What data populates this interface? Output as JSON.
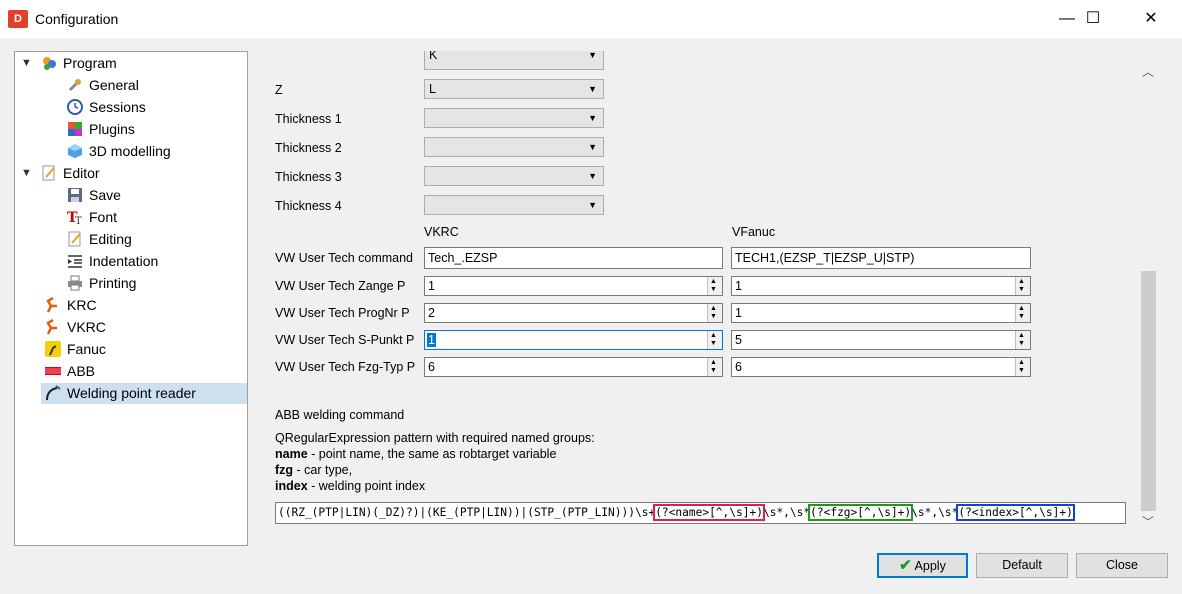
{
  "window": {
    "title": "Configuration",
    "app_icon_text": "D",
    "minimize": "—",
    "maximize": "☐",
    "close": "✕"
  },
  "tree": [
    {
      "label": "Program",
      "expanded": true,
      "icon": "program-icon"
    },
    {
      "label": "General",
      "icon": "wrench-icon"
    },
    {
      "label": "Sessions",
      "icon": "clock-icon"
    },
    {
      "label": "Plugins",
      "icon": "plugins-icon"
    },
    {
      "label": "3D modelling",
      "icon": "cube-icon"
    },
    {
      "label": "Editor",
      "expanded": true,
      "icon": "editor-icon"
    },
    {
      "label": "Save",
      "icon": "floppy-icon"
    },
    {
      "label": "Font",
      "icon": "font-icon"
    },
    {
      "label": "Editing",
      "icon": "pencil-icon"
    },
    {
      "label": "Indentation",
      "icon": "indent-icon"
    },
    {
      "label": "Printing",
      "icon": "printer-icon"
    },
    {
      "label": "KRC",
      "icon": "kuka-robot-icon"
    },
    {
      "label": "VKRC",
      "icon": "kuka-robot-icon"
    },
    {
      "label": "Fanuc",
      "icon": "fanuc-icon"
    },
    {
      "label": "ABB",
      "icon": "abb-icon"
    },
    {
      "label": "Welding point reader",
      "icon": "welding-icon",
      "selected": true
    }
  ],
  "settings": {
    "partial_combo_value": "K",
    "z": {
      "label": "Z",
      "value": "L"
    },
    "thickness": [
      {
        "label": "Thickness 1",
        "value": ""
      },
      {
        "label": "Thickness 2",
        "value": ""
      },
      {
        "label": "Thickness 3",
        "value": ""
      },
      {
        "label": "Thickness 4",
        "value": ""
      }
    ],
    "columns": {
      "vkrc": "VKRC",
      "vfanuc": "VFanuc"
    },
    "tech_command": {
      "label": "VW User Tech command",
      "vkrc": "Tech_.EZSP",
      "vfanuc": "TECH1,(EZSP_T|EZSP_U|STP)"
    },
    "spin_rows": [
      {
        "label": "VW User Tech Zange P",
        "vkrc": "1",
        "vfanuc": "1"
      },
      {
        "label": "VW User Tech ProgNr P",
        "vkrc": "2",
        "vfanuc": "1"
      },
      {
        "label": "VW User Tech S-Punkt P",
        "vkrc": "1",
        "vfanuc": "5"
      },
      {
        "label": "VW User Tech Fzg-Typ P",
        "vkrc": "6",
        "vfanuc": "6"
      }
    ],
    "abb": {
      "heading": "ABB welding command",
      "description": "QRegularExpression pattern with required named groups:",
      "groups": [
        {
          "name": "name",
          "desc": " - point name, the same as robtarget variable"
        },
        {
          "name": "fzg",
          "desc": " - car type,"
        },
        {
          "name": "index",
          "desc": " - welding point index"
        }
      ],
      "regex_prefix": "((RZ_(PTP|LIN)(_DZ)?)|(KE_(PTP|LIN))|(STP_(PTP_LIN)))\\s+",
      "regex_name": "(?<name>[^,\\s]+)",
      "regex_sep1": "\\s*,\\s*",
      "regex_fzg": "(?<fzg>[^,\\s]+)",
      "regex_sep2": "\\s*,\\s*",
      "regex_index": "(?<index>[^,\\s]+)"
    }
  },
  "buttons": {
    "apply": "Apply",
    "default": "Default",
    "close": "Close"
  },
  "colors": {
    "accent": "#0078d7",
    "name_group": "#e0204a",
    "fzg_group": "#1a9a1a",
    "index_group": "#1a3fd0"
  }
}
